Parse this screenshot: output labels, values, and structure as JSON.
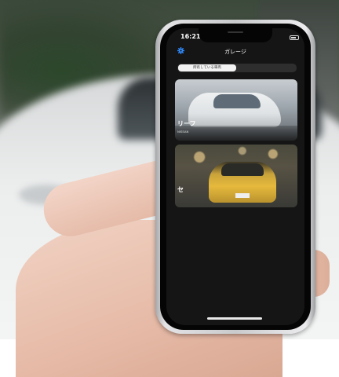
{
  "status_bar": {
    "time": "16:21"
  },
  "nav": {
    "title": "ガレージ",
    "settings_icon": "gear-icon"
  },
  "segments": {
    "tab1": "所有している車両",
    "tab2": ""
  },
  "cars": [
    {
      "name": "リーフ",
      "maker": "NISSAN"
    },
    {
      "name": "セ"
    }
  ],
  "colors": {
    "accent": "#2f8cff",
    "screen_bg": "#151515"
  }
}
